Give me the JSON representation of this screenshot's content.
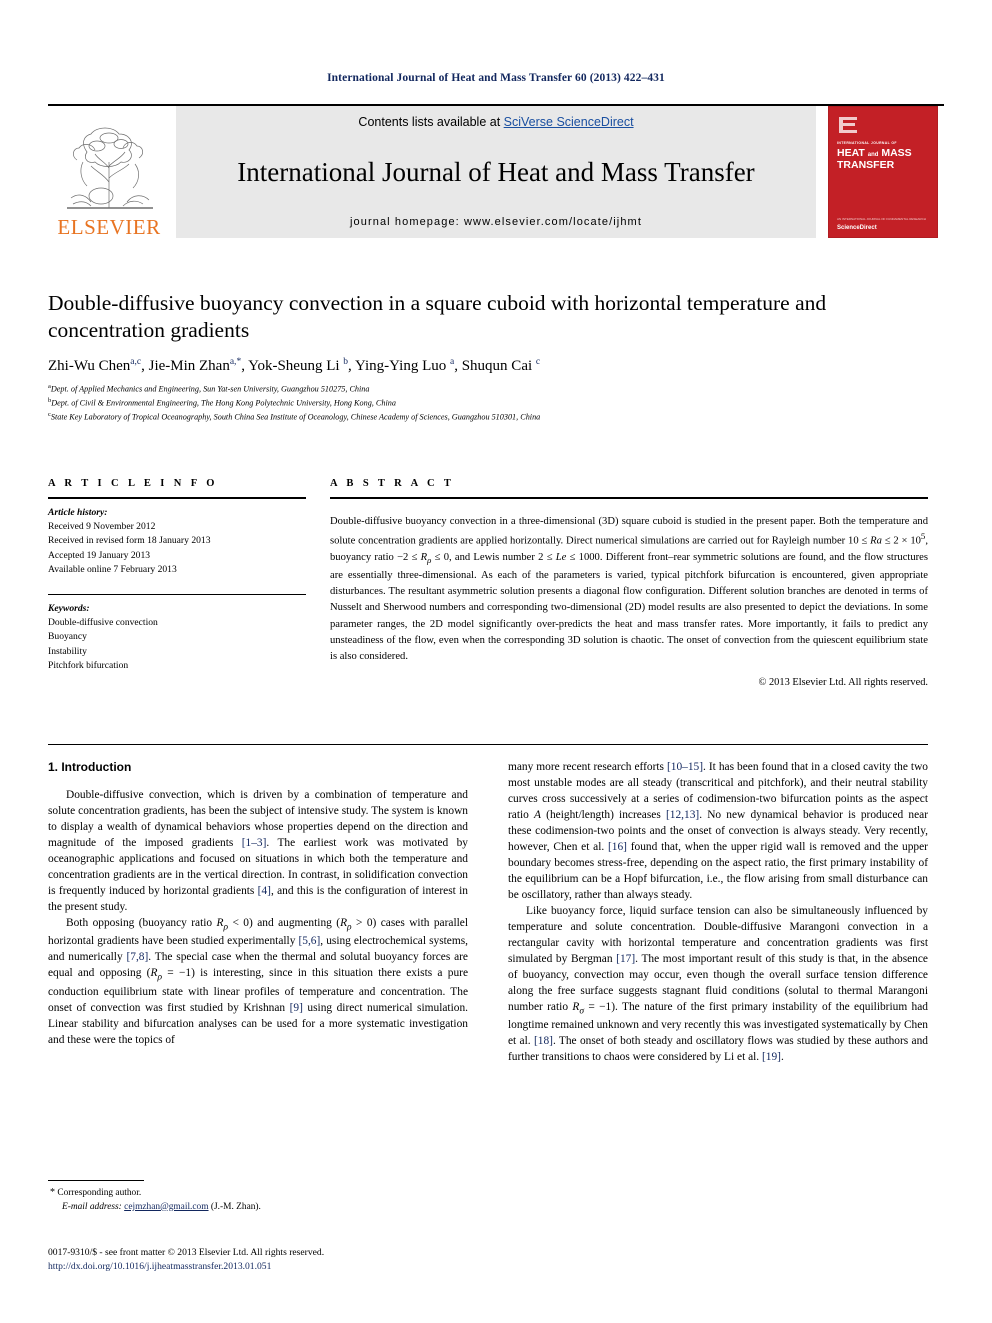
{
  "running_head": "International Journal of Heat and Mass Transfer 60 (2013) 422–431",
  "masthead": {
    "publisher_wordmark": "ELSEVIER",
    "contents_prefix": "Contents lists available at ",
    "contents_link": "SciVerse ScienceDirect",
    "journal_title": "International Journal of Heat and Mass Transfer",
    "homepage": "journal homepage: www.elsevier.com/locate/ijhmt",
    "cover": {
      "kicker": "INTERNATIONAL JOURNAL OF",
      "line1": "HEAT",
      "and": "and",
      "line2": "MASS",
      "line3": "TRANSFER",
      "foot_small": "AN INTERNATIONAL JOURNAL OF FUNDAMENTAL RESEARCH",
      "foot_brand": "ScienceDirect"
    }
  },
  "article": {
    "title": "Double-diffusive buoyancy convection in a square cuboid with horizontal temperature and concentration gradients",
    "authors_html": "Zhi-Wu Chen<sup>a,c</sup>, Jie-Min Zhan<sup>a,</sup><sup>*</sup>, Yok-Sheung Li <sup>b</sup>, Ying-Ying Luo <sup>a</sup>, Shuqun Cai <sup>c</sup>",
    "affiliations": [
      {
        "mark": "a",
        "text": "Dept. of Applied Mechanics and Engineering, Sun Yat-sen University, Guangzhou 510275, China"
      },
      {
        "mark": "b",
        "text": "Dept. of Civil & Environmental Engineering, The Hong Kong Polytechnic University, Hong Kong, China"
      },
      {
        "mark": "c",
        "text": "State Key Laboratory of Tropical Oceanography, South China Sea Institute of Oceanology, Chinese Academy of Sciences, Guangzhou 510301, China"
      }
    ]
  },
  "article_info": {
    "heading": "A R T I C L E   I N F O",
    "history_label": "Article history:",
    "history": [
      "Received 9 November 2012",
      "Received in revised form 18 January 2013",
      "Accepted 19 January 2013",
      "Available online 7 February 2013"
    ],
    "keywords_label": "Keywords:",
    "keywords": [
      "Double-diffusive convection",
      "Buoyancy",
      "Instability",
      "Pitchfork bifurcation"
    ]
  },
  "abstract": {
    "heading": "A B S T R A C T",
    "text_html": "Double-diffusive buoyancy convection in a three-dimensional (3D) square cuboid is studied in the present paper. Both the temperature and solute concentration gradients are applied horizontally. Direct numerical simulations are carried out for Rayleigh number 10 &#8804; <em class=\"var\">Ra</em> &#8804; 2 &#215; 10<sup>5</sup>, buoyancy ratio &#8722;2 &#8804; <em class=\"var\">R<sub>&#961;</sub></em> &#8804; 0, and Lewis number 2 &#8804; <em class=\"var\">Le</em> &#8804; 1000. Different front&#8211;rear symmetric solutions are found, and the flow structures are essentially three-dimensional. As each of the parameters is varied, typical pitchfork bifurcation is encountered, given appropriate disturbances. The resultant asymmetric solution presents a diagonal flow configuration. Different solution branches are denoted in terms of Nusselt and Sherwood numbers and corresponding two-dimensional (2D) model results are also presented to depict the deviations. In some parameter ranges, the 2D model significantly over-predicts the heat and mass transfer rates. More importantly, it fails to predict any unsteadiness of the flow, even when the corresponding 3D solution is chaotic. The onset of convection from the quiescent equilibrium state is also considered.",
    "copyright": "© 2013 Elsevier Ltd. All rights reserved."
  },
  "body": {
    "section_heading": "1. Introduction",
    "left_paragraphs_html": [
      "Double-diffusive convection, which is driven by a combination of temperature and solute concentration gradients, has been the subject of intensive study. The system is known to display a wealth of dynamical behaviors whose properties depend on the direction and magnitude of the imposed gradients <span class=\"ref\">[1&#8211;3]</span>. The earliest work was motivated by oceanographic applications and focused on situations in which both the temperature and concentration gradients are in the vertical direction. In contrast, in solidification convection is frequently induced by horizontal gradients <span class=\"ref\">[4]</span>, and this is the configuration of interest in the present study.",
      "Both opposing (buoyancy ratio <em class=\"var\">R<sub>&#961;</sub></em> &lt; 0) and augmenting (<em class=\"var\">R<sub>&#961;</sub></em> &gt; 0) cases with parallel horizontal gradients have been studied experimentally <span class=\"ref\">[5,6]</span>, using electrochemical systems, and numerically <span class=\"ref\">[7,8]</span>. The special case when the thermal and solutal buoyancy forces are equal and opposing (<em class=\"var\">R<sub>&#961;</sub></em> = &#8722;1) is interesting, since in this situation there exists a pure conduction equilibrium state with linear profiles of temperature and concentration. The onset of convection was first studied by Krishnan <span class=\"ref\">[9]</span> using direct numerical simulation. Linear stability and bifurcation analyses can be used for a more systematic investigation and these were the topics of"
    ],
    "right_paragraphs_html": [
      "many more recent research efforts <span class=\"ref\">[10&#8211;15]</span>. It has been found that in a closed cavity the two most unstable modes are all steady (transcritical and pitchfork), and their neutral stability curves cross successively at a series of codimension-two bifurcation points as the aspect ratio <em class=\"var\">A</em> (height/length) increases <span class=\"ref\">[12,13]</span>. No new dynamical behavior is produced near these codimension-two points and the onset of convection is always steady. Very recently, however, Chen et al. <span class=\"ref\">[16]</span> found that, when the upper rigid wall is removed and the upper boundary becomes stress-free, depending on the aspect ratio, the first primary instability of the equilibrium can be a Hopf bifurcation, i.e., the flow arising from small disturbance can be oscillatory, rather than always steady.",
      "Like buoyancy force, liquid surface tension can also be simultaneously influenced by temperature and solute concentration. Double-diffusive Marangoni convection in a rectangular cavity with horizontal temperature and concentration gradients was first simulated by Bergman <span class=\"ref\">[17]</span>. The most important result of this study is that, in the absence of buoyancy, convection may occur, even though the overall surface tension difference along the free surface suggests stagnant fluid conditions (solutal to thermal Marangoni number ratio <em class=\"var\">R<sub>&#963;</sub></em> = &#8722;1). The nature of the first primary instability of the equilibrium had longtime remained unknown and very recently this was investigated systematically by Chen et al. <span class=\"ref\">[18]</span>. The onset of both steady and oscillatory flows was studied by these authors and further transitions to chaos were considered by Li et al. <span class=\"ref\">[19]</span>."
    ]
  },
  "footnote": {
    "corresponding_star": "*",
    "corresponding_text": "Corresponding author.",
    "email_label": "E-mail address:",
    "email": "cejmzhan@gmail.com",
    "email_owner": "(J.-M. Zhan)."
  },
  "legal": {
    "issn_line": "0017-9310/$ - see front matter © 2013 Elsevier Ltd. All rights reserved.",
    "doi": "http://dx.doi.org/10.1016/j.ijheatmasstransfer.2013.01.051"
  },
  "colors": {
    "link_blue": "#12275e",
    "sciencedirect_blue": "#1a4fa0",
    "elsevier_orange": "#e87422",
    "cover_red": "#c32026",
    "band_grey": "#e8e8e8"
  }
}
